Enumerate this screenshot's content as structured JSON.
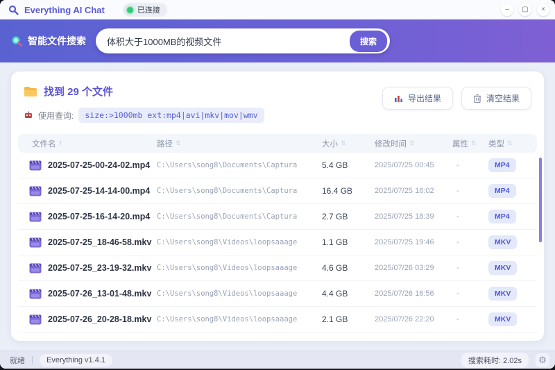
{
  "window": {
    "title": "Everything AI Chat",
    "connection_status": "已连接",
    "controls": {
      "minimize": "–",
      "maximize": "▢",
      "close": "×"
    }
  },
  "search": {
    "label": "智能文件搜索",
    "input_value": "体积大于1000MB的视频文件",
    "button_label": "搜索"
  },
  "results": {
    "summary": "找到 29 个文件",
    "query_label": "使用查询:",
    "query_value": "size:>1000mb ext:mp4|avi|mkv|mov|wmv",
    "export_label": "导出结果",
    "clear_label": "清空结果"
  },
  "table": {
    "headers": [
      {
        "label": "文件名",
        "sort": "↑",
        "active": true
      },
      {
        "label": "路径",
        "sort": "⇅",
        "active": false
      },
      {
        "label": "大小",
        "sort": "⇅",
        "active": false
      },
      {
        "label": "修改时间",
        "sort": "⇅",
        "active": false
      },
      {
        "label": "属性",
        "sort": "⇅",
        "active": false
      },
      {
        "label": "类型",
        "sort": "⇅",
        "active": false
      }
    ],
    "rows": [
      {
        "name": "2025-07-25-00-24-02.mp4",
        "path": "C:\\Users\\song8\\Documents\\Captura",
        "size": "5.4 GB",
        "time": "2025/07/25 00:45",
        "attr": "-",
        "type": "MP4"
      },
      {
        "name": "2025-07-25-14-14-00.mp4",
        "path": "C:\\Users\\song8\\Documents\\Captura",
        "size": "16.4 GB",
        "time": "2025/07/25 16:02",
        "attr": "-",
        "type": "MP4"
      },
      {
        "name": "2025-07-25-16-14-20.mp4",
        "path": "C:\\Users\\song8\\Documents\\Captura",
        "size": "2.7 GB",
        "time": "2025/07/25 18:39",
        "attr": "-",
        "type": "MP4"
      },
      {
        "name": "2025-07-25_18-46-58.mkv",
        "path": "C:\\Users\\song8\\Videos\\loopsaaage",
        "size": "1.1 GB",
        "time": "2025/07/25 19:46",
        "attr": "-",
        "type": "MKV"
      },
      {
        "name": "2025-07-25_23-19-32.mkv",
        "path": "C:\\Users\\song8\\Videos\\loopsaaage",
        "size": "4.6 GB",
        "time": "2025/07/26 03:29",
        "attr": "-",
        "type": "MKV"
      },
      {
        "name": "2025-07-26_13-01-48.mkv",
        "path": "C:\\Users\\song8\\Videos\\loopsaaage",
        "size": "4.4 GB",
        "time": "2025/07/26 16:56",
        "attr": "-",
        "type": "MKV"
      },
      {
        "name": "2025-07-26_20-28-18.mkv",
        "path": "C:\\Users\\song8\\Videos\\loopsaaage",
        "size": "2.1 GB",
        "time": "2025/07/26 22:20",
        "attr": "-",
        "type": "MKV"
      }
    ]
  },
  "statusbar": {
    "status": "就绪",
    "version": "Everything v1.4.1",
    "search_time": "搜索耗时: 2.02s",
    "gear_glyph": "⚙"
  },
  "colors": {
    "accent": "#5b5bd6",
    "gradient_start": "#5a62d2",
    "gradient_end": "#7e60d4",
    "connected_green": "#2ecc71",
    "badge_bg": "#e4e8fb",
    "badge_text": "#4f5bd5",
    "folder_yellow": "#f5b942",
    "file_icon_purple": "#7b68d9"
  }
}
